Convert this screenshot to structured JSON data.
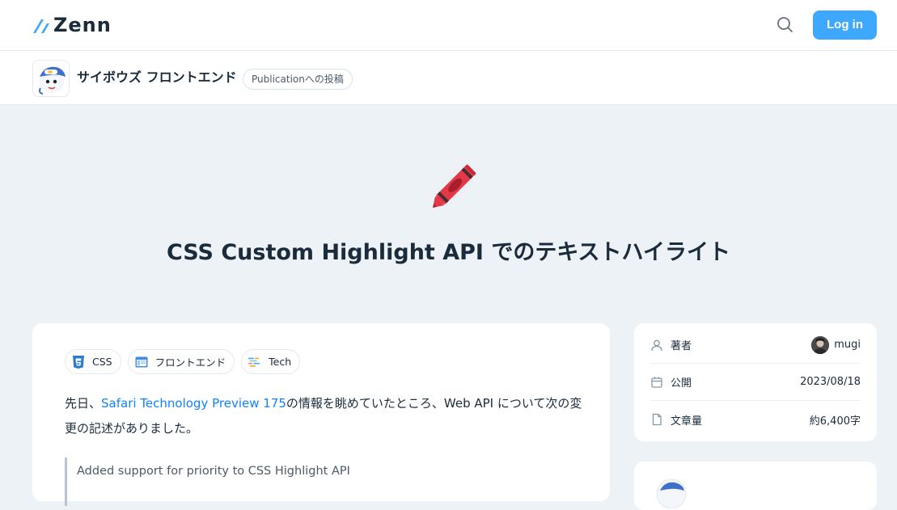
{
  "header": {
    "logo_text": "Zenn",
    "login_label": "Log in",
    "search_icon": "search-icon"
  },
  "publication": {
    "name": "サイボウズ フロントエンド",
    "badge": "Publicationへの投稿"
  },
  "article": {
    "emoji": "crayon",
    "title": "CSS Custom Highlight API でのテキストハイライト",
    "tags": [
      {
        "label": "CSS",
        "icon": "css-icon"
      },
      {
        "label": "フロントエンド",
        "icon": "browser-window-icon"
      },
      {
        "label": "Tech",
        "icon": "tech-icon"
      }
    ],
    "para_prefix": "先日、",
    "para_link": "Safari Technology Preview 175",
    "para_suffix": "の情報を眺めていたところ、Web API について次の変更の記述がありました。",
    "quote": "Added support for priority to CSS Highlight API"
  },
  "sidebar": {
    "author_label": "著者",
    "author_name": "mugi",
    "published_label": "公開",
    "published_date": "2023/08/18",
    "length_label": "文章量",
    "length_value": "約6,400字"
  },
  "colors": {
    "accent": "#3ea8ff",
    "link": "#0f83fd",
    "background": "#edf2f7"
  }
}
